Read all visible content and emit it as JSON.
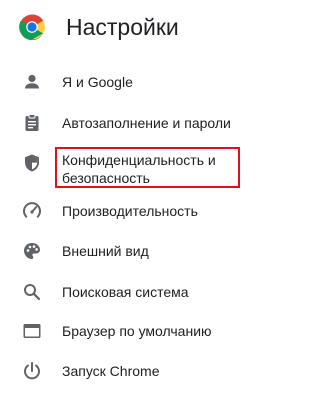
{
  "header": {
    "logo_icon": "chrome-logo-icon",
    "title": "Настройки"
  },
  "nav": {
    "items": [
      {
        "icon": "person-icon",
        "label": "Я и Google"
      },
      {
        "icon": "clipboard-icon",
        "label": "Автозаполнение и пароли"
      },
      {
        "icon": "shield-icon",
        "label": "Конфиденциальность и безопасность",
        "highlighted": true
      },
      {
        "icon": "speedometer-icon",
        "label": "Производительность"
      },
      {
        "icon": "palette-icon",
        "label": "Внешний вид"
      },
      {
        "icon": "search-icon",
        "label": "Поисковая система"
      },
      {
        "icon": "browser-icon",
        "label": "Браузер по умолчанию"
      },
      {
        "icon": "power-icon",
        "label": "Запуск Chrome"
      }
    ]
  },
  "colors": {
    "text": "#202124",
    "icon": "#5f6368",
    "highlight_border": "#e0101f"
  }
}
